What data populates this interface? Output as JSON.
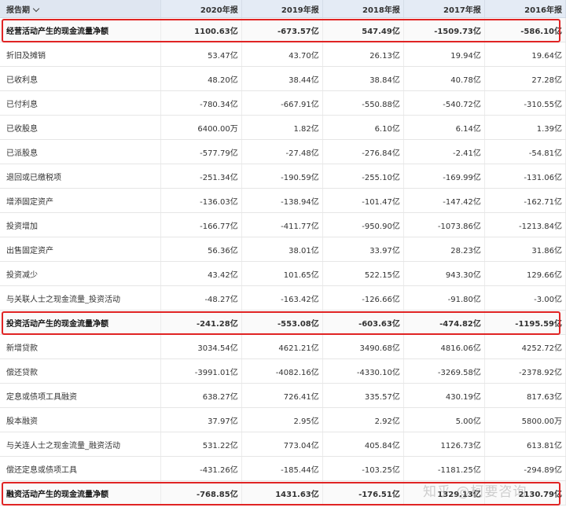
{
  "header": {
    "col0": "报告期",
    "years": [
      "2020年报",
      "2019年报",
      "2018年报",
      "2017年报",
      "2016年报"
    ]
  },
  "rows": [
    {
      "name": "经营活动产生的现金流量净额",
      "values": [
        "1100.63亿",
        "-673.57亿",
        "547.49亿",
        "-1509.73亿",
        "-586.10亿"
      ],
      "highlight": true
    },
    {
      "name": "折旧及摊销",
      "values": [
        "53.47亿",
        "43.70亿",
        "26.13亿",
        "19.94亿",
        "19.64亿"
      ]
    },
    {
      "name": "已收利息",
      "values": [
        "48.20亿",
        "38.44亿",
        "38.84亿",
        "40.78亿",
        "27.28亿"
      ]
    },
    {
      "name": "已付利息",
      "values": [
        "-780.34亿",
        "-667.91亿",
        "-550.88亿",
        "-540.72亿",
        "-310.55亿"
      ]
    },
    {
      "name": "已收股息",
      "values": [
        "6400.00万",
        "1.82亿",
        "6.10亿",
        "6.14亿",
        "1.39亿"
      ]
    },
    {
      "name": "已派股息",
      "values": [
        "-577.79亿",
        "-27.48亿",
        "-276.84亿",
        "-2.41亿",
        "-54.81亿"
      ]
    },
    {
      "name": "退回或已缴税项",
      "values": [
        "-251.34亿",
        "-190.59亿",
        "-255.10亿",
        "-169.99亿",
        "-131.06亿"
      ]
    },
    {
      "name": "增添固定资产",
      "values": [
        "-136.03亿",
        "-138.94亿",
        "-101.47亿",
        "-147.42亿",
        "-162.71亿"
      ]
    },
    {
      "name": "投资增加",
      "values": [
        "-166.77亿",
        "-411.77亿",
        "-950.90亿",
        "-1073.86亿",
        "-1213.84亿"
      ]
    },
    {
      "name": "出售固定资产",
      "values": [
        "56.36亿",
        "38.01亿",
        "33.97亿",
        "28.23亿",
        "31.86亿"
      ]
    },
    {
      "name": "投资减少",
      "values": [
        "43.42亿",
        "101.65亿",
        "522.15亿",
        "943.30亿",
        "129.66亿"
      ]
    },
    {
      "name": "与关联人士之现金流量_投资活动",
      "values": [
        "-48.27亿",
        "-163.42亿",
        "-126.66亿",
        "-91.80亿",
        "-3.00亿"
      ]
    },
    {
      "name": "投资活动产生的现金流量净额",
      "values": [
        "-241.28亿",
        "-553.08亿",
        "-603.63亿",
        "-474.82亿",
        "-1195.59亿"
      ],
      "highlight": true
    },
    {
      "name": "新增贷款",
      "values": [
        "3034.54亿",
        "4621.21亿",
        "3490.68亿",
        "4816.06亿",
        "4252.72亿"
      ]
    },
    {
      "name": "偿还贷款",
      "values": [
        "-3991.01亿",
        "-4082.16亿",
        "-4330.10亿",
        "-3269.58亿",
        "-2378.92亿"
      ]
    },
    {
      "name": "定息或债项工具融资",
      "values": [
        "638.27亿",
        "726.41亿",
        "335.57亿",
        "430.19亿",
        "817.63亿"
      ]
    },
    {
      "name": "股本融资",
      "values": [
        "37.97亿",
        "2.95亿",
        "2.92亿",
        "5.00亿",
        "5800.00万"
      ]
    },
    {
      "name": "与关连人士之现金流量_融资活动",
      "values": [
        "531.22亿",
        "773.04亿",
        "405.84亿",
        "1126.73亿",
        "613.81亿"
      ]
    },
    {
      "name": "偿还定息或债项工具",
      "values": [
        "-431.26亿",
        "-185.44亿",
        "-103.25亿",
        "-1181.25亿",
        "-294.89亿"
      ]
    },
    {
      "name": "融资活动产生的现金流量净额",
      "values": [
        "-768.85亿",
        "1431.63亿",
        "-176.51亿",
        "1329.13亿",
        "2130.79亿"
      ],
      "highlight": true
    }
  ],
  "watermark": "知乎 @柯要咨询",
  "colors": {
    "header_bg": "#e4ebf5",
    "highlight_border": "#e02424"
  }
}
